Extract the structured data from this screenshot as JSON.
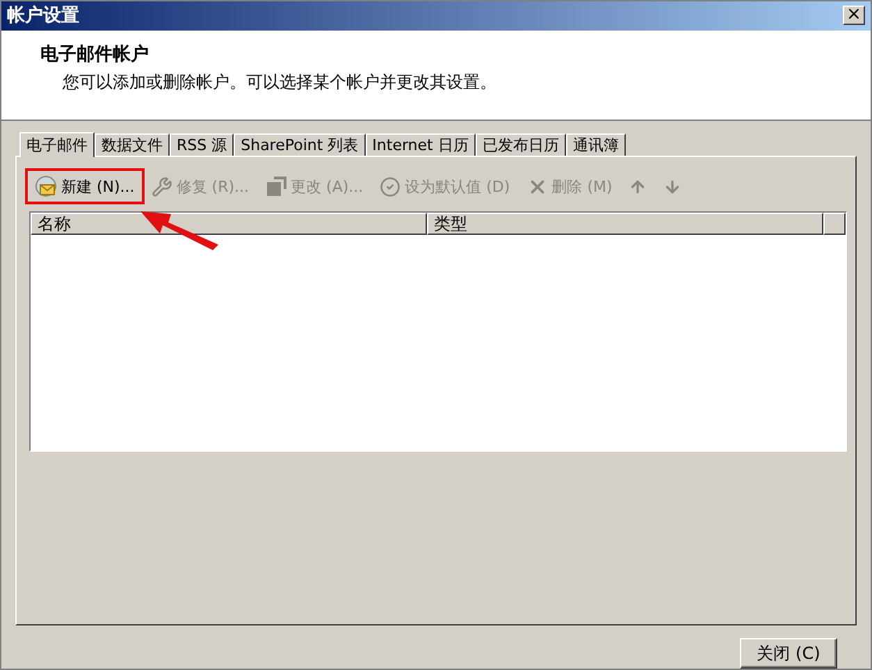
{
  "window": {
    "title": "帐户设置",
    "close_glyph": "×"
  },
  "header": {
    "title": "电子邮件帐户",
    "description": "您可以添加或删除帐户。可以选择某个帐户并更改其设置。"
  },
  "tabs": [
    {
      "label": "电子邮件",
      "selected": true
    },
    {
      "label": "数据文件",
      "selected": false
    },
    {
      "label": "RSS 源",
      "selected": false
    },
    {
      "label": "SharePoint 列表",
      "selected": false
    },
    {
      "label": "Internet 日历",
      "selected": false
    },
    {
      "label": "已发布日历",
      "selected": false
    },
    {
      "label": "通讯簿",
      "selected": false
    }
  ],
  "toolbar": [
    {
      "kind": "new",
      "label": "新建 (N)...",
      "disabled": false,
      "highlighted": true
    },
    {
      "kind": "repair",
      "label": "修复 (R)...",
      "disabled": true,
      "highlighted": false
    },
    {
      "kind": "change",
      "label": "更改 (A)...",
      "disabled": true,
      "highlighted": false
    },
    {
      "kind": "default",
      "label": "设为默认值 (D)",
      "disabled": true,
      "highlighted": false
    },
    {
      "kind": "delete",
      "label": "删除 (M)",
      "disabled": true,
      "highlighted": false
    },
    {
      "kind": "up",
      "disabled": true,
      "highlighted": false
    },
    {
      "kind": "down",
      "disabled": true,
      "highlighted": false
    }
  ],
  "table": {
    "columns": [
      "名称",
      "类型"
    ]
  },
  "buttons": [
    {
      "label": "关闭 (C)"
    }
  ]
}
